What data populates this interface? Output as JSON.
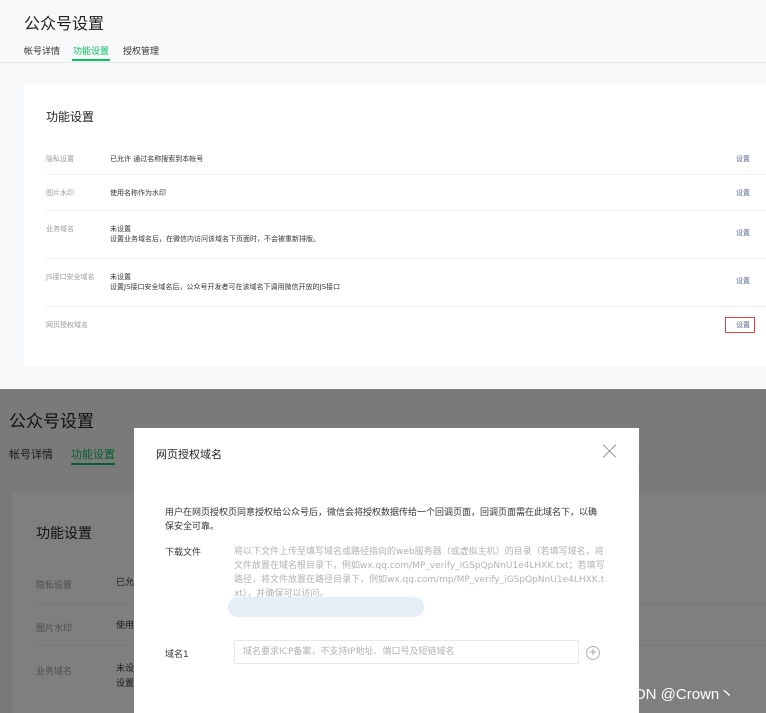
{
  "top": {
    "page_title": "公众号设置",
    "tabs": [
      {
        "label": "帐号详情",
        "active": false
      },
      {
        "label": "功能设置",
        "active": true
      },
      {
        "label": "授权管理",
        "active": false
      }
    ],
    "card_title": "功能设置",
    "rows": [
      {
        "label": "隐私设置",
        "value": "已允许 通过名称搜索到本帐号",
        "desc": "",
        "action": "设置"
      },
      {
        "label": "图片水印",
        "value": "使用名称作为水印",
        "desc": "",
        "action": "设置"
      },
      {
        "label": "业务域名",
        "value": "未设置",
        "desc": "设置业务域名后，在微信内访问该域名下页面时，不会被重新排版。",
        "action": "设置"
      },
      {
        "label": "JS接口安全域名",
        "value": "未设置",
        "desc": "设置JS接口安全域名后，公众号开发者可在该域名下调用微信开放的JS接口",
        "action": "设置"
      },
      {
        "label": "网页授权域名",
        "value": "",
        "desc": "",
        "action": "设置",
        "highlighted": true
      }
    ]
  },
  "bottom": {
    "page_title": "公众号设置",
    "tabs": [
      {
        "label": "帐号详情",
        "active": false
      },
      {
        "label": "功能设置",
        "active": true
      }
    ],
    "card_title": "功能设置",
    "rows": [
      {
        "label": "隐私设置",
        "value": "已允"
      },
      {
        "label": "图片水印",
        "value": "使用"
      },
      {
        "label": "业务域名",
        "value": "未设",
        "value2": "设置"
      }
    ],
    "dialog": {
      "title": "网页授权域名",
      "description": "用户在网页授权页同意授权给公众号后，微信会将授权数据传给一个回调页面，回调页面需在此域名下，以确保安全可靠。",
      "download_label": "下载文件",
      "download_text": "将以下文件上传至填写域名或路径指向的web服务器（或虚拟主机）的目录（若填写域名，将文件放置在域名根目录下，例如wx.qq.com/MP_verify_iGSpQpNnU1e4LHXK.txt；若填写路径，将文件放置在路径目录下，例如wx.qq.com/mp/MP_verify_iGSpQpNnU1e4LHXK.txt），并确保可以访问。",
      "domain_label": "域名1",
      "domain_placeholder": "域名要求ICP备案，不支持IP地址、端口号及短链域名",
      "domain_value": ""
    }
  },
  "watermark": "CSDN @Crown丶",
  "colors": {
    "accent": "#07c160",
    "link": "#576b95",
    "highlight": "#e64340",
    "overlay": "rgba(0,0,0,0.5)"
  },
  "icons": {
    "close": "close-icon",
    "add": "plus-circle-icon"
  }
}
